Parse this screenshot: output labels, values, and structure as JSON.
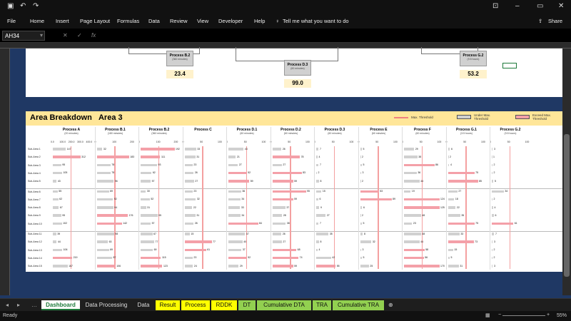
{
  "quick_access": {
    "save_icon": "save-icon",
    "undo_icon": "undo-icon",
    "redo_icon": "redo-icon"
  },
  "window": {
    "minimize": "–",
    "restore": "▭",
    "close": "✕"
  },
  "ribbon": {
    "tabs": [
      "File",
      "Home",
      "Insert",
      "Page Layout",
      "Formulas",
      "Data",
      "Review",
      "View",
      "Developer",
      "Help"
    ],
    "tell_me": "Tell me what you want to do",
    "share": "Share"
  },
  "formula_bar": {
    "name_box": "AH34",
    "cancel": "✕",
    "enter": "✓",
    "fx": "fx"
  },
  "top_panel": {
    "processes": [
      {
        "name": "Process B.2",
        "duration": "(360 minutes)",
        "value": "23.4"
      },
      {
        "name": "Process D.3",
        "duration": "(60 minutes)",
        "value": "99.0"
      },
      {
        "name": "Process G.2",
        "duration": "(9.5 hours)",
        "value": "53.2"
      }
    ]
  },
  "section": {
    "title": "Area Breakdown",
    "area": "Area 3",
    "legend": {
      "max_threshold": "Max. Threshold",
      "under_max": "Under Max. Threshold",
      "exceed_max": "Exceed Max. Threshold"
    },
    "colors": {
      "under": "#d0d0d0",
      "exceed": "#f4a0a8",
      "threshold": "#f08080",
      "header": "#ffe699"
    }
  },
  "chart_data": {
    "type": "bar",
    "columns": [
      {
        "name": "Process A",
        "duration": "(20 minutes)",
        "ticks": [
          "0.0",
          "100.0",
          "200.0",
          "300.0",
          "400.0"
        ],
        "max": 400,
        "values": [
          147,
          312,
          95,
          105,
          43,
          55,
          62,
          67,
          95,
          102,
          39,
          44,
          106,
          219,
          167
        ]
      },
      {
        "name": "Process B.1",
        "duration": "(180 minutes)",
        "ticks": [
          "0",
          "100",
          "200"
        ],
        "max": 200,
        "values": [
          32,
          183,
          78,
          78,
          96,
          69,
          92,
          94,
          176,
          142,
          98,
          63,
          69,
          87,
          106
        ]
      },
      {
        "name": "Process B.2",
        "duration": "(360 minutes)",
        "ticks": [
          "0",
          "100",
          "200"
        ],
        "max": 200,
        "values": [
          192,
          111,
          93,
          62,
          57,
          30,
          52,
          31,
          95,
          57,
          67,
          77,
          69,
          115,
          123
        ]
      },
      {
        "name": "Process C",
        "duration": "",
        "ticks": [
          "0",
          "50",
          "100"
        ],
        "max": 100,
        "values": [
          33,
          31,
          23,
          26,
          27,
          23,
          32,
          22,
          31,
          26,
          15,
          77,
          61,
          23,
          24
        ]
      },
      {
        "name": "Process D.1",
        "duration": "(60 minutes)",
        "ticks": [
          "0",
          "50",
          "100"
        ],
        "max": 100,
        "values": [
          43,
          21,
          27,
          52,
          59,
          36,
          34,
          33,
          34,
          84,
          47,
          40,
          37,
          52,
          29
        ]
      },
      {
        "name": "Process D.2",
        "duration": "(60 minutes)",
        "ticks": [
          "0",
          "50",
          "100"
        ],
        "max": 100,
        "values": [
          26,
          78,
          27,
          83,
          59,
          95,
          59,
          37,
          28,
          38,
          26,
          27,
          68,
          74,
          59
        ]
      },
      {
        "name": "Process D.3",
        "duration": "(60 minutes)",
        "ticks": [
          "0",
          "50",
          "100"
        ],
        "max": 100,
        "values": [
          7,
          4,
          7,
          2,
          8,
          15,
          6,
          9,
          27,
          7,
          35,
          8,
          4,
          42,
          55
        ]
      },
      {
        "name": "Process E",
        "duration": "(60 minutes)",
        "ticks": [
          "0",
          "50",
          "100"
        ],
        "max": 100,
        "values": [
          5,
          2,
          5,
          3,
          2,
          53,
          89,
          6,
          2,
          5,
          8,
          32,
          3,
          5,
          25
        ]
      },
      {
        "name": "Process F",
        "duration": "(60 minutes)",
        "ticks": [
          "0",
          "50",
          "100"
        ],
        "max": 100,
        "values": [
          29,
          38,
          86,
          36,
          44,
          19,
          124,
          125,
          48,
          23,
          48,
          44,
          58,
          56,
          170
        ]
      },
      {
        "name": "Process G.1",
        "duration": "(3.5 hours)",
        "ticks": [
          "0",
          "50",
          "100"
        ],
        "max": 100,
        "values": [
          6,
          2,
          4,
          75,
          85,
          27,
          18,
          22,
          35,
          75,
          33,
          73,
          15,
          5,
          31
        ]
      },
      {
        "name": "Process G.2",
        "duration": "(9.5 hours)",
        "ticks": [
          "0",
          "50",
          "100"
        ],
        "max": 100,
        "values": [
          3,
          1,
          2,
          2,
          5,
          34,
          2,
          4,
          6,
          61,
          7,
          3,
          2,
          2,
          3
        ]
      }
    ],
    "rows": [
      "Sub-Area 1",
      "Sub-Area 2",
      "Sub-Area 3",
      "Sub-Area 4",
      "Sub-Area 5",
      "Sub-Area 6",
      "Sub-Area 7",
      "Sub-Area 8",
      "Sub-Area 9",
      "Sub-Area 10",
      "Sub-Area 11",
      "Sub-Area 12",
      "Sub-Area 13",
      "Sub-Area 14",
      "Sub-Area 15"
    ]
  },
  "sheet_tabs": [
    {
      "label": "Dashboard",
      "bg": "#ffffff",
      "fg": "#1d7a3a",
      "active": true
    },
    {
      "label": "Data Processing",
      "bg": "#1e1e1e",
      "fg": "#dddddd"
    },
    {
      "label": "Data",
      "bg": "#1e1e1e",
      "fg": "#dddddd"
    },
    {
      "label": "Result",
      "bg": "#ffff00",
      "fg": "#111111"
    },
    {
      "label": "Process",
      "bg": "#ffff00",
      "fg": "#111111"
    },
    {
      "label": "RDDK",
      "bg": "#ffff00",
      "fg": "#111111"
    },
    {
      "label": "DT",
      "bg": "#92d050",
      "fg": "#111111"
    },
    {
      "label": "Cumulative DTA",
      "bg": "#92d050",
      "fg": "#111111"
    },
    {
      "label": "TRA",
      "bg": "#92d050",
      "fg": "#111111"
    },
    {
      "label": "Cumulative TRA",
      "bg": "#92d050",
      "fg": "#111111"
    }
  ],
  "status": {
    "ready": "Ready",
    "zoom": "55%"
  }
}
